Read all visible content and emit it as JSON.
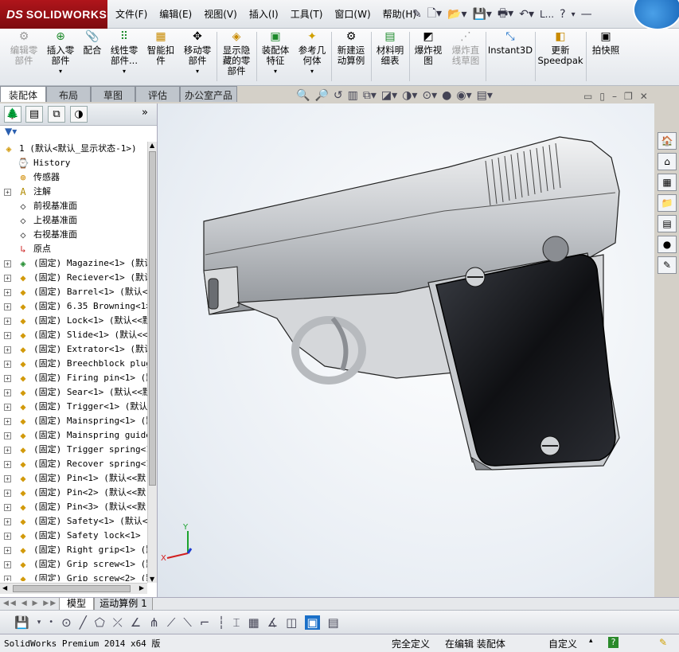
{
  "app": {
    "brand_ds": "DS",
    "brand_name": "SOLIDWORKS"
  },
  "menu": [
    "文件(F)",
    "编辑(E)",
    "视图(V)",
    "插入(I)",
    "工具(T)",
    "窗口(W)",
    "帮助(H)"
  ],
  "quick_access": {
    "help_label": "?",
    "more_label": "L..."
  },
  "commands": [
    {
      "label": "编辑零\n部件",
      "icon": "edit-component-icon",
      "enabled": false
    },
    {
      "label": "插入零\n部件",
      "icon": "insert-component-icon",
      "enabled": true
    },
    {
      "label": "配合",
      "icon": "mate-icon",
      "enabled": true
    },
    {
      "label": "线性零\n部件...",
      "icon": "linear-pattern-icon",
      "enabled": true
    },
    {
      "label": "智能扣\n件",
      "icon": "smart-fastener-icon",
      "enabled": true
    },
    {
      "label": "移动零\n部件",
      "icon": "move-component-icon",
      "enabled": true
    },
    {
      "label": "显示隐\n藏的零\n部件",
      "icon": "show-hidden-icon",
      "enabled": true
    },
    {
      "label": "装配体\n特征",
      "icon": "assembly-feature-icon",
      "enabled": true
    },
    {
      "label": "参考几\n何体",
      "icon": "reference-geometry-icon",
      "enabled": true
    },
    {
      "label": "新建运\n动算例",
      "icon": "motion-study-icon",
      "enabled": true
    },
    {
      "label": "材料明\n细表",
      "icon": "bom-icon",
      "enabled": true
    },
    {
      "label": "爆炸视\n图",
      "icon": "exploded-view-icon",
      "enabled": true
    },
    {
      "label": "爆炸直\n线草图",
      "icon": "explode-line-icon",
      "enabled": false
    },
    {
      "label": "Instant3D",
      "icon": "instant3d-icon",
      "enabled": true
    },
    {
      "label": "更新\nSpeedpak",
      "icon": "speedpak-icon",
      "enabled": true
    },
    {
      "label": "拍快照",
      "icon": "snapshot-icon",
      "enabled": true
    }
  ],
  "command_tabs": [
    "装配体",
    "布局",
    "草图",
    "评估",
    "办公室产品"
  ],
  "tree": {
    "root": "1  (默认<默认_显示状态-1>)",
    "nodes": [
      {
        "label": "History",
        "icon": "history-icon",
        "expand": ""
      },
      {
        "label": "传感器",
        "icon": "sensor-icon",
        "expand": ""
      },
      {
        "label": "注解",
        "icon": "annotation-icon",
        "expand": "+"
      },
      {
        "label": "前视基准面",
        "icon": "plane-icon",
        "expand": ""
      },
      {
        "label": "上视基准面",
        "icon": "plane-icon",
        "expand": ""
      },
      {
        "label": "右视基准面",
        "icon": "plane-icon",
        "expand": ""
      },
      {
        "label": "原点",
        "icon": "origin-icon",
        "expand": ""
      },
      {
        "label": "(固定) Magazine<1> (默认",
        "icon": "subassembly-icon",
        "expand": "+"
      },
      {
        "label": "(固定) Reciever<1> (默认",
        "icon": "part-icon",
        "expand": "+"
      },
      {
        "label": "(固定) Barrel<1> (默认<",
        "icon": "part-icon",
        "expand": "+"
      },
      {
        "label": "(固定) 6.35 Browning<1>",
        "icon": "part-icon",
        "expand": "+"
      },
      {
        "label": "(固定) Lock<1> (默认<<默",
        "icon": "part-icon",
        "expand": "+"
      },
      {
        "label": "(固定) Slide<1> (默认<<",
        "icon": "part-icon",
        "expand": "+"
      },
      {
        "label": "(固定) Extrator<1> (默认",
        "icon": "part-icon",
        "expand": "+"
      },
      {
        "label": "(固定) Breechblock plug",
        "icon": "part-icon",
        "expand": "+"
      },
      {
        "label": "(固定) Firing pin<1> (默",
        "icon": "part-icon",
        "expand": "+"
      },
      {
        "label": "(固定) Sear<1> (默认<<默",
        "icon": "part-icon",
        "expand": "+"
      },
      {
        "label": "(固定) Trigger<1> (默认",
        "icon": "part-icon",
        "expand": "+"
      },
      {
        "label": "(固定) Mainspring<1> (默",
        "icon": "part-icon",
        "expand": "+"
      },
      {
        "label": "(固定) Mainspring guide",
        "icon": "part-icon",
        "expand": "+"
      },
      {
        "label": "(固定) Trigger spring<1",
        "icon": "part-icon",
        "expand": "+"
      },
      {
        "label": "(固定) Recover spring<1",
        "icon": "part-icon",
        "expand": "+"
      },
      {
        "label": "(固定) Pin<1> (默认<<默",
        "icon": "part-icon",
        "expand": "+"
      },
      {
        "label": "(固定) Pin<2> (默认<<默",
        "icon": "part-icon",
        "expand": "+"
      },
      {
        "label": "(固定) Pin<3> (默认<<默",
        "icon": "part-icon",
        "expand": "+"
      },
      {
        "label": "(固定) Safety<1> (默认<",
        "icon": "part-icon",
        "expand": "+"
      },
      {
        "label": "(固定) Safety lock<1> (",
        "icon": "part-icon",
        "expand": "+"
      },
      {
        "label": "(固定) Right grip<1> (默",
        "icon": "part-icon",
        "expand": "+"
      },
      {
        "label": "(固定) Grip screw<1> (默",
        "icon": "part-icon",
        "expand": "+"
      },
      {
        "label": "(固定) Grip screw<2> (默",
        "icon": "part-icon",
        "expand": "+"
      }
    ]
  },
  "bottom_tabs": [
    "模型",
    "运动算例 1"
  ],
  "status": {
    "version": "SolidWorks Premium 2014 x64 版",
    "definition": "完全定义",
    "editing": "在编辑 装配体",
    "units": "自定义",
    "help": "?"
  },
  "triad": {
    "x": "X",
    "y": "Y"
  },
  "colors": {
    "brand_red": "#a01218",
    "grip": "#1b1c20",
    "body": "#c9cbce",
    "accent_blue": "#1a6fc8"
  }
}
